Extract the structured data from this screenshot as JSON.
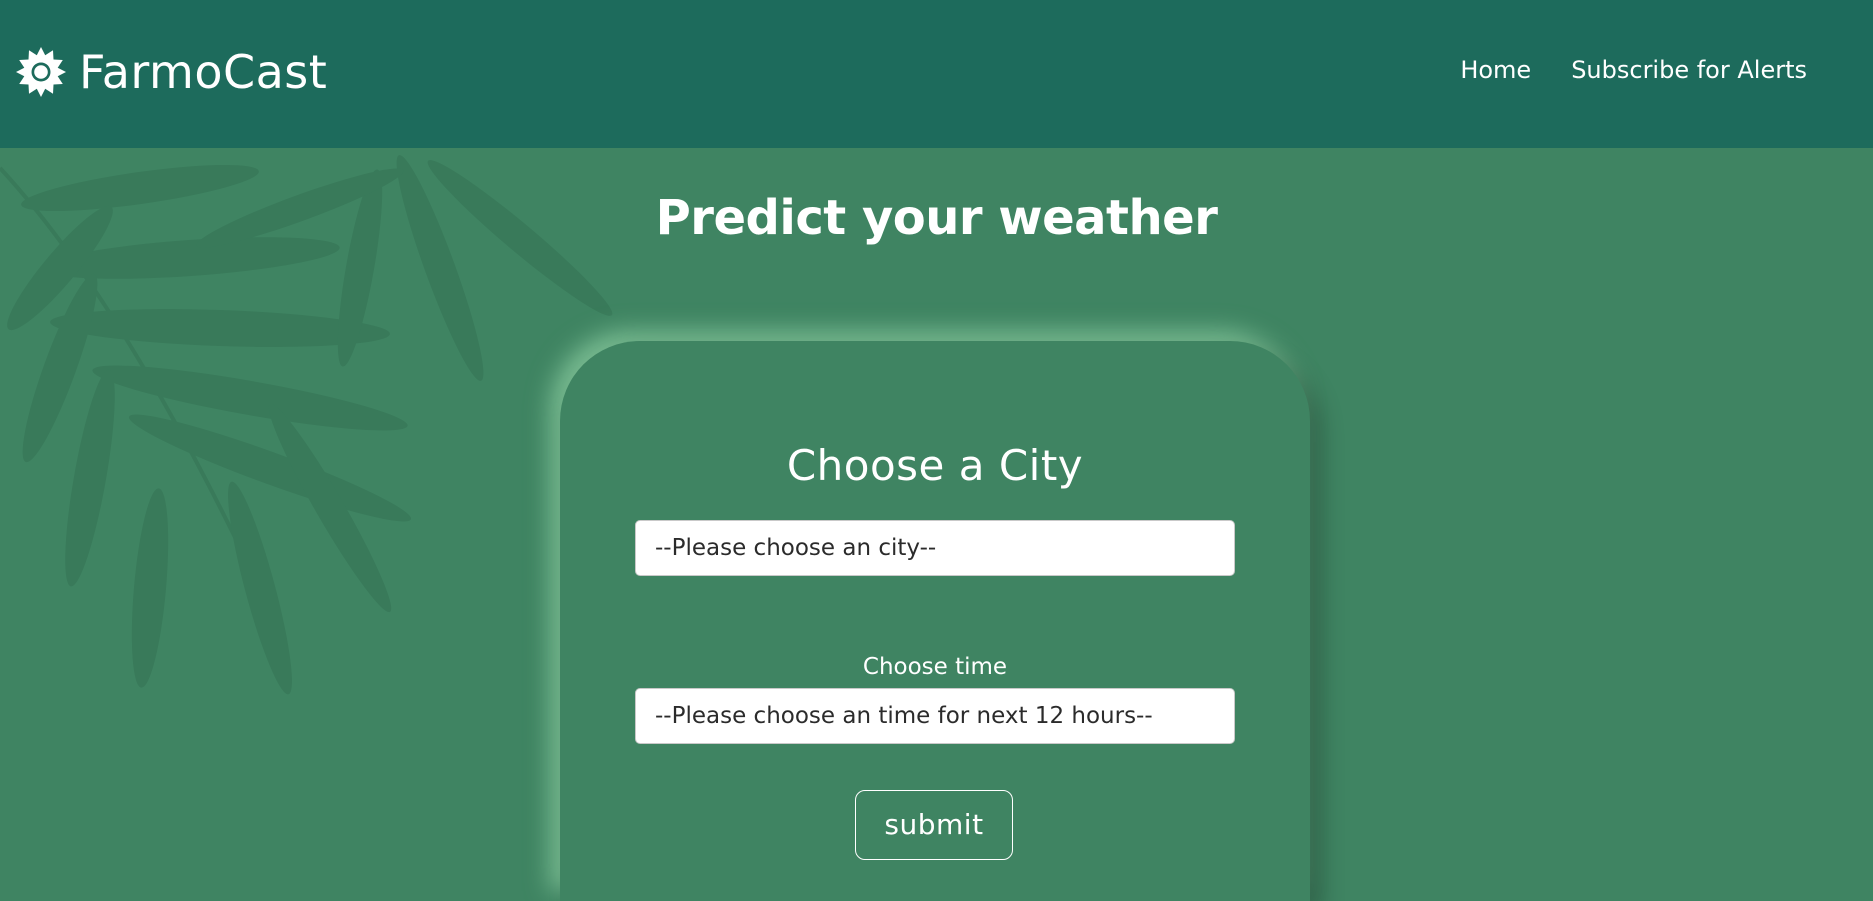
{
  "header": {
    "brand_name": "FarmoCast",
    "brand_icon": "sun-icon",
    "nav": [
      {
        "label": "Home"
      },
      {
        "label": "Subscribe for Alerts"
      }
    ]
  },
  "main": {
    "title": "Predict your weather",
    "form": {
      "city_heading": "Choose a City",
      "city_select_value": "--Please choose an city--",
      "time_label": "Choose time",
      "time_select_value": "--Please choose an time for next 12 hours--",
      "submit_label": "submit"
    }
  },
  "colors": {
    "header_bg": "#1d6b5c",
    "page_bg": "#3f8462",
    "text": "#ffffff",
    "leaf_shadow": "#2f6a4e"
  },
  "decor": {
    "background_image": "palm-leaf-shadow"
  }
}
